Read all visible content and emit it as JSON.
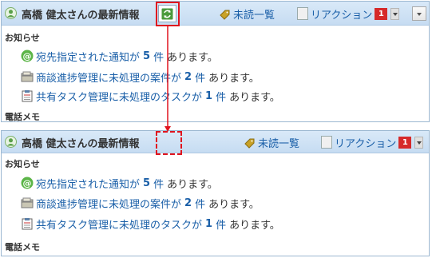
{
  "panels": [
    {
      "title": "高橋 健太さんの最新情報",
      "unread_label": "未読一覧",
      "reaction_label": "リアクション",
      "reaction_badge": "1",
      "notice_heading": "お知らせ",
      "notifications": [
        {
          "link": "宛先指定された通知が",
          "count": "5",
          "unit": "件",
          "suffix": "あります。"
        },
        {
          "link": "商談進捗管理に未処理の案件が",
          "count": "2",
          "unit": "件",
          "suffix": "あります。"
        },
        {
          "link": "共有タスク管理に未処理のタスクが",
          "count": "1",
          "unit": "件",
          "suffix": "あります。"
        }
      ],
      "memo_heading": "電話メモ"
    },
    {
      "title": "高橋 健太さんの最新情報",
      "unread_label": "未読一覧",
      "reaction_label": "リアクション",
      "reaction_badge": "1",
      "notice_heading": "お知らせ",
      "notifications": [
        {
          "link": "宛先指定された通知が",
          "count": "5",
          "unit": "件",
          "suffix": "あります。"
        },
        {
          "link": "商談進捗管理に未処理の案件が",
          "count": "2",
          "unit": "件",
          "suffix": "あります。"
        },
        {
          "link": "共有タスク管理に未処理のタスクが",
          "count": "1",
          "unit": "件",
          "suffix": "あります。"
        }
      ],
      "memo_heading": "電話メモ"
    }
  ],
  "icons": {
    "user": "user-icon",
    "refresh": "refresh-icon",
    "unread": "tag-icon",
    "mention": "at-mention-icon",
    "deal": "folder-icon",
    "task": "clipboard-icon"
  },
  "colors": {
    "header_bg": "#c6dcf2",
    "link": "#1a5fa8",
    "badge": "#d62a2a",
    "annotation": "#e0141e"
  }
}
